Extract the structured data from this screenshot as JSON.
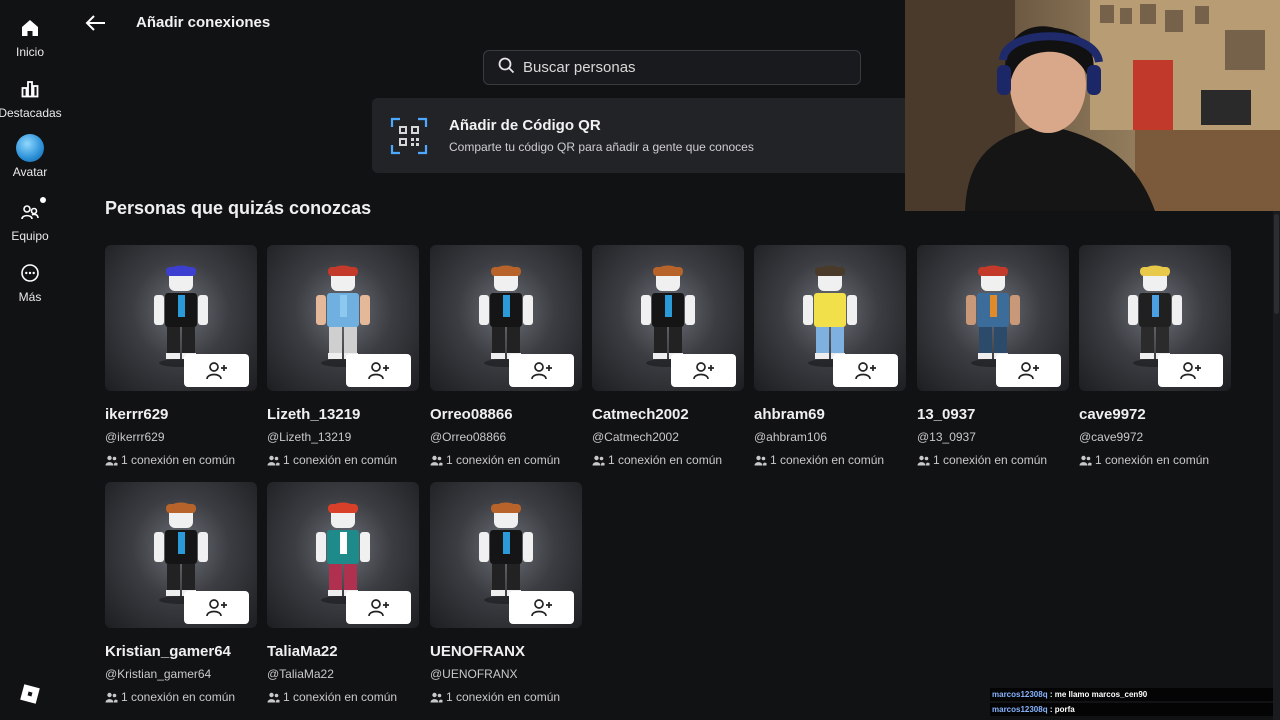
{
  "sidebar": {
    "items": [
      {
        "label": "Inicio",
        "icon": "home-icon"
      },
      {
        "label": "Destacadas",
        "icon": "charts-icon"
      },
      {
        "label": "Avatar",
        "icon": "avatar-icon"
      },
      {
        "label": "Equipo",
        "icon": "party-icon"
      },
      {
        "label": "Más",
        "icon": "more-icon"
      }
    ]
  },
  "header": {
    "title": "Añadir conexiones"
  },
  "search": {
    "placeholder": "Buscar personas"
  },
  "qr": {
    "title": "Añadir de Código QR",
    "subtitle": "Comparte tu código QR para añadir a gente que conoces"
  },
  "section": {
    "title": "Personas que quizás conozcas"
  },
  "people": [
    {
      "name": "ikerrr629",
      "handle": "@ikerrr629",
      "mutual": "1 conexión en común"
    },
    {
      "name": "Lizeth_13219",
      "handle": "@Lizeth_13219",
      "mutual": "1 conexión en común"
    },
    {
      "name": "Orreo08866",
      "handle": "@Orreo08866",
      "mutual": "1 conexión en común"
    },
    {
      "name": "Catmech2002",
      "handle": "@Catmech2002",
      "mutual": "1 conexión en común"
    },
    {
      "name": "ahbram69",
      "handle": "@ahbram106",
      "mutual": "1 conexión en común"
    },
    {
      "name": "13_0937",
      "handle": "@13_0937",
      "mutual": "1 conexión en común"
    },
    {
      "name": "cave9972",
      "handle": "@cave9972",
      "mutual": "1 conexión en común"
    },
    {
      "name": "Kristian_gamer64",
      "handle": "@Kristian_gamer64",
      "mutual": "1 conexión en común"
    },
    {
      "name": "TaliaMa22",
      "handle": "@TaliaMa22",
      "mutual": "1 conexión en común"
    },
    {
      "name": "UENOFRANX",
      "handle": "@UENOFRANX",
      "mutual": "1 conexión en común"
    }
  ],
  "chat": [
    {
      "user": "marcos12308q",
      "message": ": me llamo marcos_cen90"
    },
    {
      "user": "marcos12308q",
      "message": ": porfa"
    }
  ],
  "colors": {
    "background": "#111214",
    "card": "#222327",
    "add_button": "#ffffff",
    "chat_user": "#86b4ff"
  }
}
